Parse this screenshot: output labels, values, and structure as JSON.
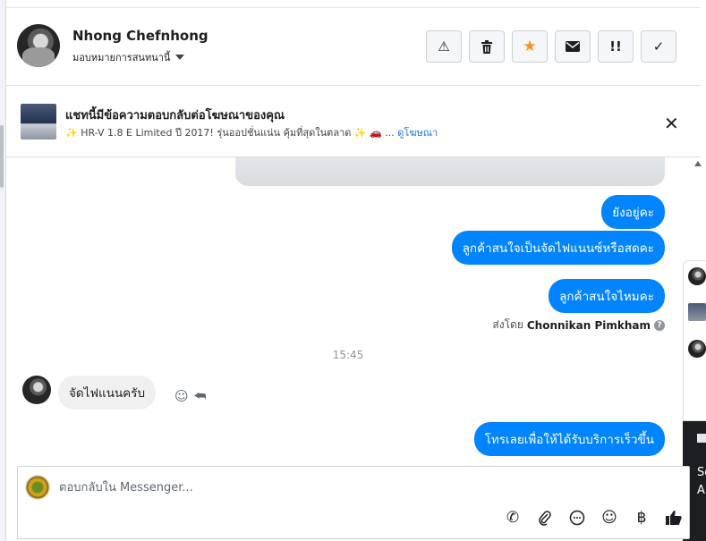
{
  "contact": {
    "name": "Nhong Chefnhong",
    "assign_label": "มอบหมายการสนทนานี้"
  },
  "toolbar": {
    "buttons": [
      {
        "name": "spam-button",
        "glyph": "⚠"
      },
      {
        "name": "delete-button",
        "glyph": "🗑"
      },
      {
        "name": "star-button",
        "glyph": "★"
      },
      {
        "name": "mark-unread-button",
        "glyph": "✉"
      },
      {
        "name": "follow-up-button",
        "glyph": "!!"
      },
      {
        "name": "done-button",
        "glyph": "✓"
      }
    ],
    "accent_star": "#f7931e"
  },
  "ad_banner": {
    "title": "แชทนี้มีข้อความตอบกลับต่อโฆษณาของคุณ",
    "description": "✨ HR-V 1.8 E Limited ปี 2017! รุ่นออปชั่นแน่น คุ้มที่สุดในตลาด ✨ 🚗 ...",
    "link": "ดูโฆษณา"
  },
  "messages": {
    "out_1": "ยังอยู่คะ",
    "out_2": "ลูกค้าสนใจเป็นจัดไฟแนนซ์หรือสดคะ",
    "out_3": "ลูกค้าสนใจไหมคะ",
    "sent_by_prefix": "ส่งโดย",
    "sent_by_name": "Chonnikan Pimkham",
    "time_separator": "15:45",
    "in_1": "จัดไฟแนนครับ",
    "out_4": "โทรเลยเพื่อให้ได้รับบริการเร็วขึ้น"
  },
  "composer": {
    "placeholder": "ตอบกลับใน Messenger..."
  },
  "side_peek": {
    "text_1": "So",
    "text_2": "A"
  },
  "colors": {
    "outgoing_bubble": "#0084ff",
    "incoming_bubble": "#f1f0f0",
    "link": "#1b74e4"
  }
}
